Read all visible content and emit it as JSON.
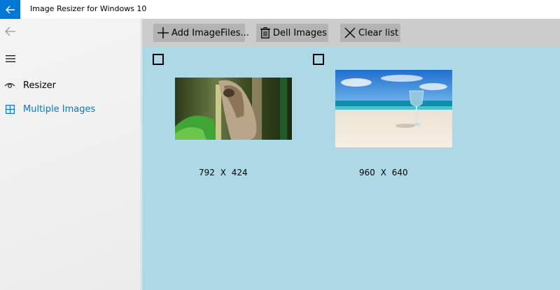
{
  "window": {
    "title": "Image Resizer for Windows 10"
  },
  "sidebar": {
    "items": [
      {
        "label": "Resizer",
        "icon": "eye-icon",
        "selected": false
      },
      {
        "label": "Multiple Images",
        "icon": "grid-icon",
        "selected": true
      }
    ]
  },
  "toolbar": {
    "add_label": "Add ImageFiles...",
    "delete_label": "Dell Images",
    "clear_label": "Clear list"
  },
  "images": [
    {
      "dims": "792  X  424",
      "checked": false,
      "description_icon": "sloth-thumbnail"
    },
    {
      "dims": "960  X  640",
      "checked": false,
      "description_icon": "beach-thumbnail"
    }
  ],
  "colors": {
    "accent": "#0078d7",
    "main_background": "#add8e6",
    "toolbar_background": "#cccccc",
    "button_background": "#b3b3b3"
  }
}
